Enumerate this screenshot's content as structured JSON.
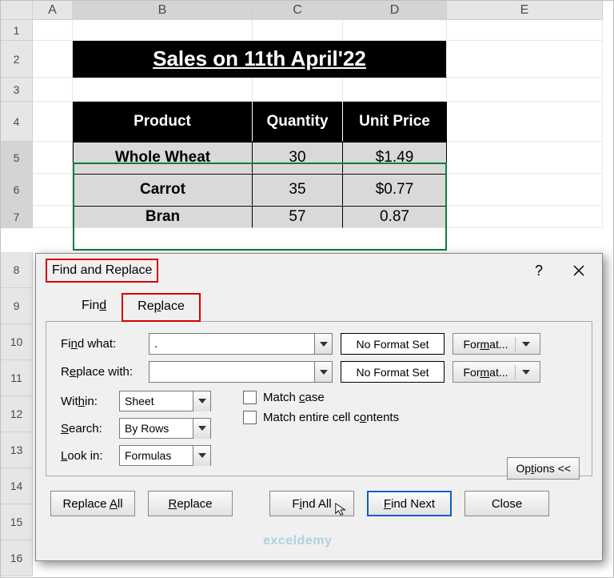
{
  "columns": [
    "A",
    "B",
    "C",
    "D",
    "E"
  ],
  "rows": [
    "1",
    "2",
    "3",
    "4",
    "5",
    "6",
    "7",
    "8",
    "9",
    "10",
    "11",
    "12",
    "13",
    "14",
    "15",
    "16"
  ],
  "title": "Sales on 11th April'22",
  "headers": {
    "product": "Product",
    "quantity": "Quantity",
    "unit_price": "Unit Price"
  },
  "data": [
    {
      "product": "Whole Wheat",
      "quantity": "30",
      "unit_price": "$1.49"
    },
    {
      "product": "Carrot",
      "quantity": "35",
      "unit_price": "$0.77"
    },
    {
      "product": "Bran",
      "quantity": "57",
      "unit_price": "0.87"
    }
  ],
  "dialog": {
    "title": "Find and Replace",
    "help": "?",
    "tabs": {
      "find": "Find",
      "replace": "Replace"
    },
    "labels": {
      "find_what": "Find what:",
      "replace_with": "Replace with:",
      "within": "Within:",
      "search": "Search:",
      "look_in": "Look in:",
      "match_case": "Match case",
      "match_entire": "Match entire cell contents"
    },
    "fields": {
      "find_what": ".",
      "replace_with": ""
    },
    "dropdowns": {
      "within": "Sheet",
      "search": "By Rows",
      "look_in": "Formulas"
    },
    "format_chip": "No Format Set",
    "format_btn": "Format...",
    "options_btn": "Options <<",
    "buttons": {
      "replace_all": "Replace All",
      "replace": "Replace",
      "find_all": "Find All",
      "find_next": "Find Next",
      "close": "Close"
    }
  },
  "watermark": "exceldemy",
  "chart_data": {
    "type": "table",
    "title": "Sales on 11th April'22",
    "columns": [
      "Product",
      "Quantity",
      "Unit Price"
    ],
    "rows": [
      [
        "Whole Wheat",
        30,
        1.49
      ],
      [
        "Carrot",
        35,
        0.77
      ],
      [
        "Bran",
        57,
        0.87
      ]
    ]
  }
}
